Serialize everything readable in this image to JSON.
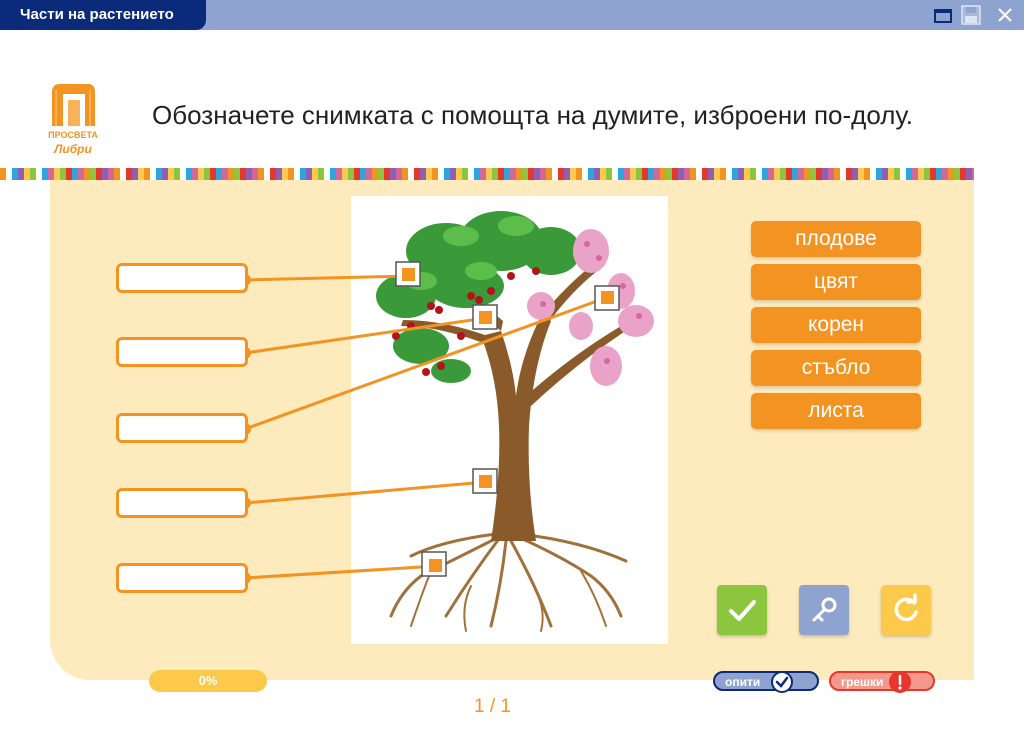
{
  "window": {
    "title": "Части на растението"
  },
  "logo": {
    "text_top": "ПРОСВЕТА",
    "text_bottom": "Либри"
  },
  "instruction": "Обозначете снимката с помощта на думите, изброени по-долу.",
  "label_boxes": [
    "",
    "",
    "",
    "",
    ""
  ],
  "word_bank": [
    "плодове",
    "цвят",
    "корен",
    "стъбло",
    "листа"
  ],
  "actions": {
    "check": {
      "color": "#8cc63f",
      "icon": "check-icon"
    },
    "key": {
      "color": "#8ea3cf",
      "icon": "key-icon"
    },
    "reset": {
      "color": "#fcc94a",
      "icon": "refresh-icon"
    }
  },
  "progress": {
    "value": 0,
    "label": "0%"
  },
  "pager": "1 / 1",
  "attempts": {
    "label": "опити",
    "color": "#8ea3cf"
  },
  "errors": {
    "label": "грешки",
    "color": "#f2998c"
  },
  "colors": {
    "accent": "#f39321",
    "panel": "#feebbd",
    "titlebar": "#0c2a7a"
  }
}
